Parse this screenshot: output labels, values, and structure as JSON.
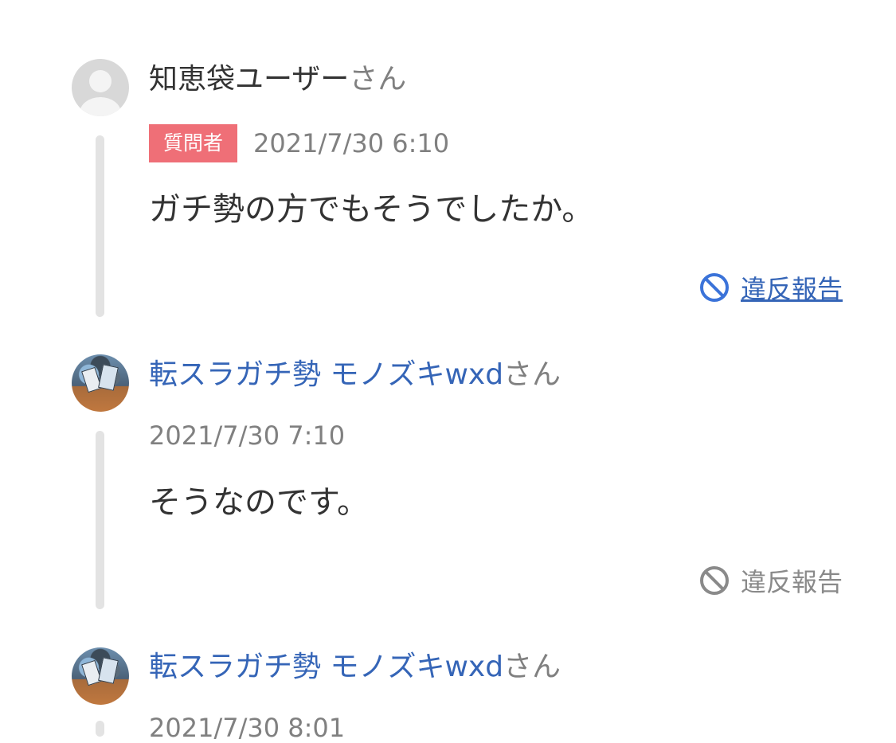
{
  "comments": [
    {
      "author": "知恵袋ユーザー",
      "honorific": "さん",
      "badge": "質問者",
      "timestamp": "2021/7/30 6:10",
      "text": "ガチ勢の方でもそうでしたか。",
      "report_label": "違反報告"
    },
    {
      "author": "転スラガチ勢 モノズキwxd",
      "honorific": "さん",
      "timestamp": "2021/7/30 7:10",
      "text": "そうなのです。",
      "report_label": "違反報告"
    },
    {
      "author": "転スラガチ勢 モノズキwxd",
      "honorific": "さん",
      "timestamp": "2021/7/30 8:01"
    }
  ],
  "colors": {
    "link": "#3565b7",
    "badge": "#ef6f77",
    "muted": "#808080",
    "rail": "#e3e3e3"
  },
  "icons": {
    "report": "prohibited-icon",
    "default_avatar": "user-silhouette-icon"
  }
}
